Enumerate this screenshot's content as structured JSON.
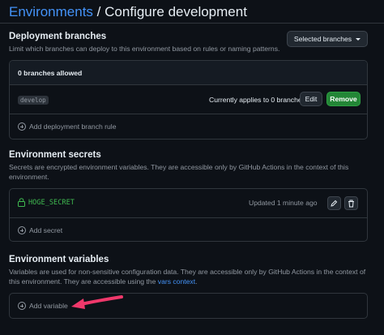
{
  "header": {
    "breadcrumb_link": "Environments",
    "separator": "/",
    "page_title": "Configure development"
  },
  "deployment_branches": {
    "title": "Deployment branches",
    "description": "Limit which branches can deploy to this environment based on rules or naming patterns.",
    "selector_label": "Selected branches",
    "allowed_count_label": "0 branches allowed",
    "rule": {
      "pattern": "develop",
      "status": "Currently applies to 0 branches",
      "edit_label": "Edit",
      "remove_label": "Remove"
    },
    "add_rule_label": "Add deployment branch rule"
  },
  "environment_secrets": {
    "title": "Environment secrets",
    "description": "Secrets are encrypted environment variables. They are accessible only by GitHub Actions in the context of this environment.",
    "secrets": [
      {
        "name": "HOGE_SECRET",
        "updated": "Updated 1 minute ago"
      }
    ],
    "add_label": "Add secret"
  },
  "environment_variables": {
    "title": "Environment variables",
    "description_before_link": "Variables are used for non-sensitive configuration data. They are accessible only by GitHub Actions in the context of this environment. They are accessible using the",
    "link_text": "vars context",
    "description_after_link": ".",
    "add_label": "Add variable"
  },
  "colors": {
    "background": "#0d1117",
    "accent_link": "#4493f8",
    "success_green": "#238636",
    "secret_green": "#3fb950",
    "annotation_arrow": "#f0386b"
  },
  "icons": [
    "caret-down-icon",
    "lock-icon",
    "pencil-icon",
    "trash-icon",
    "plus-circle-icon",
    "annotation-arrow-icon"
  ]
}
